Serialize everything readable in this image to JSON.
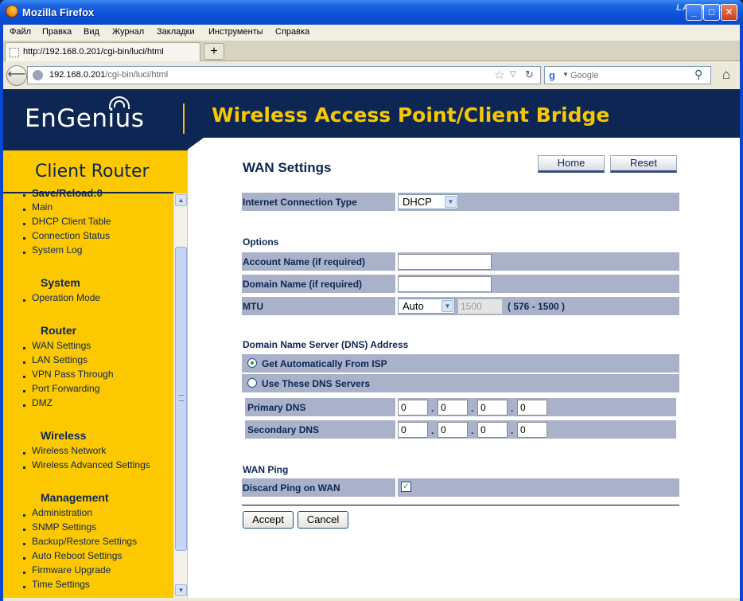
{
  "window": {
    "title": "Mozilla Firefox",
    "watermark": "LANMART"
  },
  "menubar": [
    "Файл",
    "Правка",
    "Вид",
    "Журнал",
    "Закладки",
    "Инструменты",
    "Справка"
  ],
  "tab": {
    "label": "http://192.168.0.201/cgi-bin/luci/html"
  },
  "address": {
    "host": "192.168.0.201",
    "path": "/cgi-bin/luci/html"
  },
  "search": {
    "placeholder": "Google"
  },
  "banner": {
    "logo": "EnGenius",
    "logo_mark": "®",
    "heading": "Wireless Access Point/Client Bridge"
  },
  "sidebar": {
    "title": "Client Router",
    "items": [
      {
        "label": "Save/Reload:0",
        "type": "item",
        "bold": true
      },
      {
        "label": "Main",
        "type": "item"
      },
      {
        "label": "DHCP Client Table",
        "type": "item"
      },
      {
        "label": "Connection Status",
        "type": "item"
      },
      {
        "label": "System Log",
        "type": "item"
      },
      {
        "label": "System",
        "type": "heading"
      },
      {
        "label": "Operation Mode",
        "type": "item"
      },
      {
        "label": "Router",
        "type": "heading"
      },
      {
        "label": "WAN Settings",
        "type": "item"
      },
      {
        "label": "LAN Settings",
        "type": "item"
      },
      {
        "label": "VPN Pass Through",
        "type": "item"
      },
      {
        "label": "Port Forwarding",
        "type": "item"
      },
      {
        "label": "DMZ",
        "type": "item"
      },
      {
        "label": "Wireless",
        "type": "heading"
      },
      {
        "label": "Wireless Network",
        "type": "item"
      },
      {
        "label": "Wireless Advanced Settings",
        "type": "item"
      },
      {
        "label": "Management",
        "type": "heading"
      },
      {
        "label": "Administration",
        "type": "item"
      },
      {
        "label": "SNMP Settings",
        "type": "item"
      },
      {
        "label": "Backup/Restore Settings",
        "type": "item"
      },
      {
        "label": "Auto Reboot Settings",
        "type": "item"
      },
      {
        "label": "Firmware Upgrade",
        "type": "item"
      },
      {
        "label": "Time Settings",
        "type": "item"
      }
    ]
  },
  "content": {
    "title": "WAN Settings",
    "home_label": "Home",
    "reset_label": "Reset",
    "connection_type_label": "Internet Connection Type",
    "connection_type_value": "DHCP",
    "options_title": "Options",
    "account_label": "Account Name (if required)",
    "account_value": "",
    "domain_label": "Domain Name (if required)",
    "domain_value": "",
    "mtu_label": "MTU",
    "mtu_mode": "Auto",
    "mtu_value": "1500",
    "mtu_range": "( 576 - 1500 )",
    "dns_title": "Domain Name Server (DNS) Address",
    "dns_auto_label": "Get Automatically From ISP",
    "dns_manual_label": "Use These DNS Servers",
    "primary_dns_label": "Primary DNS",
    "primary_dns": [
      "0",
      "0",
      "0",
      "0"
    ],
    "secondary_dns_label": "Secondary DNS",
    "secondary_dns": [
      "0",
      "0",
      "0",
      "0"
    ],
    "wan_ping_title": "WAN Ping",
    "discard_ping_label": "Discard Ping on WAN",
    "discard_ping_checked": true,
    "accept_label": "Accept",
    "cancel_label": "Cancel"
  }
}
